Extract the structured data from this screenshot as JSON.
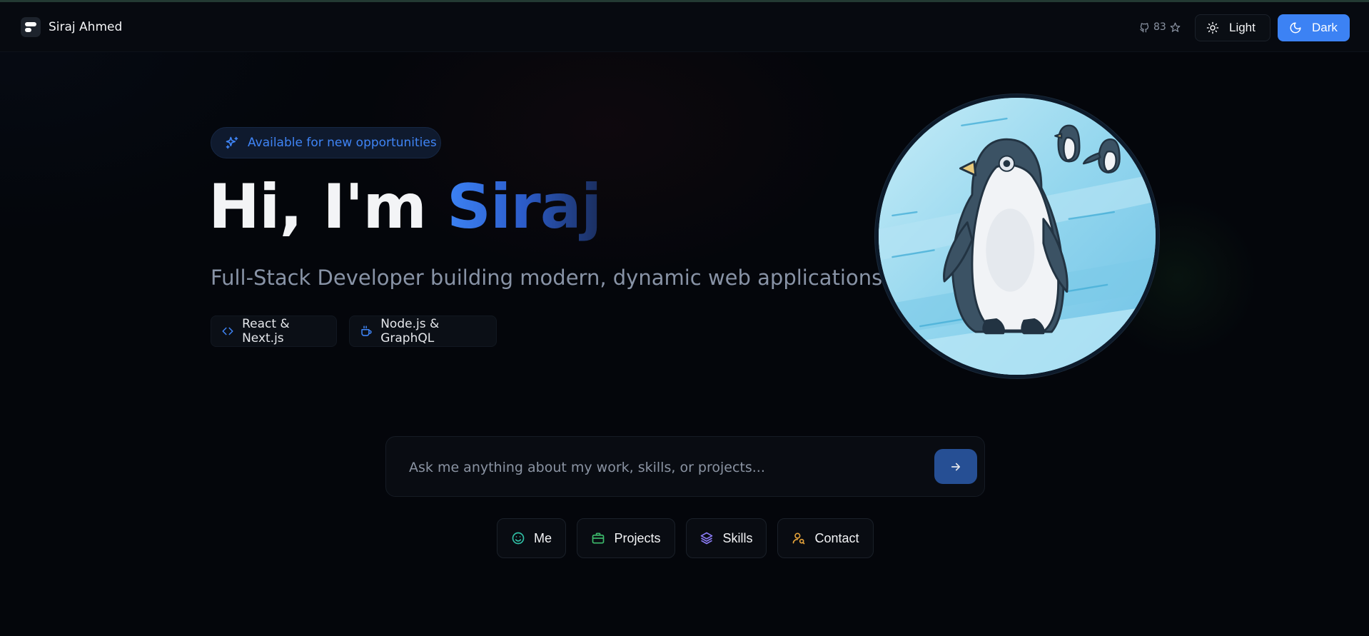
{
  "header": {
    "brand_name": "Siraj Ahmed",
    "github_stars": "83",
    "theme": {
      "light_label": "Light",
      "dark_label": "Dark",
      "selected": "Dark"
    }
  },
  "hero": {
    "badge": "Available for new opportunities",
    "greeting": "Hi, I'm ",
    "name": "Siraj",
    "subtitle": "Full-Stack Developer building modern, dynamic web applications.",
    "chips": [
      {
        "label": "React & Next.js",
        "icon": "code-icon"
      },
      {
        "label": "Node.js & GraphQL",
        "icon": "coffee-icon"
      }
    ]
  },
  "chat": {
    "placeholder": "Ask me anything about my work, skills, or projects...",
    "value": ""
  },
  "quick_actions": [
    {
      "label": "Me",
      "icon": "smiley-icon",
      "color": "#2fbfa5"
    },
    {
      "label": "Projects",
      "icon": "briefcase-icon",
      "color": "#3dbb6c"
    },
    {
      "label": "Skills",
      "icon": "layers-icon",
      "color": "#8b7cf6"
    },
    {
      "label": "Contact",
      "icon": "user-search-icon",
      "color": "#e4a23a"
    }
  ],
  "colors": {
    "accent": "#3c82f4",
    "background": "#04060b"
  }
}
